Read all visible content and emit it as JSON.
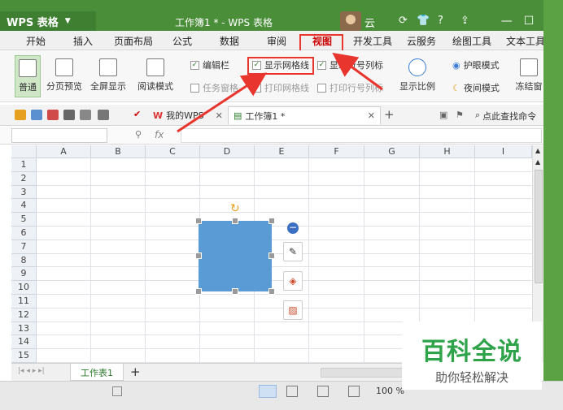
{
  "app": {
    "logo": "WPS 表格",
    "title": "工作簿1 * - WPS 表格",
    "user_label": "云",
    "accent_color": "#4a8e3a",
    "highlight_color": "#e8352e"
  },
  "window_controls": {
    "minimize": "—",
    "maximize": "☐",
    "close": "✕"
  },
  "menu_tabs": [
    "开始",
    "插入",
    "页面布局",
    "公式",
    "数据",
    "审阅",
    "视图",
    "开发工具",
    "云服务",
    "绘图工具",
    "文本工具"
  ],
  "ribbon": {
    "normal": "普通",
    "page_break": "分页预览",
    "fullscreen": "全屏显示",
    "reading": "阅读模式",
    "editbar": "编辑栏",
    "show_grid": "显示网格线",
    "show_rowcol": "显示行号列标",
    "task_pane": "任务窗格",
    "print_grid": "打印网格线",
    "print_rowcol": "打印行号列标",
    "zoom": "显示比例",
    "eye_mode": "护眼模式",
    "night_mode": "夜间模式",
    "freeze": "冻结窗"
  },
  "toolbar": {
    "my_wps": "我的WPS",
    "workbook_tab": "工作簿1 *",
    "search": "点此查找命令",
    "add_tab": "+"
  },
  "formula": {
    "fx": "fx"
  },
  "columns": [
    "A",
    "B",
    "C",
    "D",
    "E",
    "F",
    "G",
    "H",
    "I"
  ],
  "rows": [
    "1",
    "2",
    "3",
    "4",
    "5",
    "6",
    "7",
    "8",
    "9",
    "10",
    "11",
    "12",
    "13",
    "14",
    "15"
  ],
  "sheet": {
    "name": "工作表1",
    "add": "+"
  },
  "status": {
    "zoom": "100 %"
  },
  "watermark": {
    "title": "百科全说",
    "subtitle": "助你轻松解决"
  }
}
